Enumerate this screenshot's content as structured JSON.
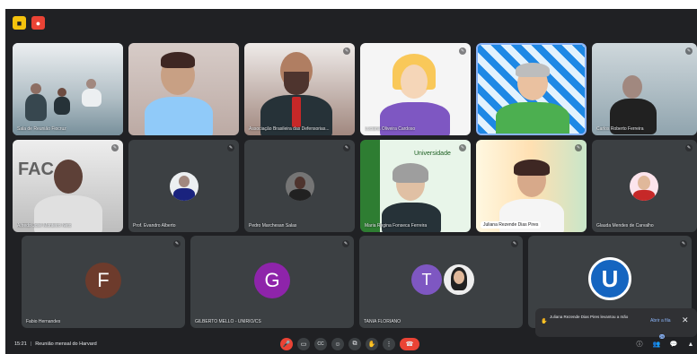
{
  "top_icons": [
    {
      "icon": "meet-logo-icon",
      "glyph": "■"
    },
    {
      "icon": "record-icon",
      "glyph": "●"
    }
  ],
  "participants": [
    {
      "name": "Sala de Reunião Fiocruz"
    },
    {
      "name": ""
    },
    {
      "name": "Associação Brasileira das Defensorias..."
    },
    {
      "name": "Luciana Oliveira Cardoso"
    },
    {
      "name": ""
    },
    {
      "name": "Carlos Roberto Ferreira"
    },
    {
      "name": "Alfredo José Monteiro Neto"
    },
    {
      "name": "Prof. Evandro Alberto"
    },
    {
      "name": "Pedro Marchesan Salas"
    },
    {
      "name": "Maria Regina Fonseca Ferreira"
    },
    {
      "name": "Juliana Rezende Dias Pires"
    },
    {
      "name": "Glauda Mendes de Carvalho"
    },
    {
      "name": "Fabio Hernandes",
      "letter": "F",
      "color": "#6d3b2c"
    },
    {
      "name": "GILBERTO MELLO - UNIRIO/CS",
      "letter": "G",
      "color": "#8e24aa"
    },
    {
      "name": "TANIA FLORIANO",
      "letter": "T",
      "color": "#7e57c2"
    },
    {
      "name": "",
      "letter": "U",
      "color": "#1565c0"
    }
  ],
  "toast": {
    "text": "Juliana Rezende Dias Pires levantou a mão",
    "link": "Abrir a fila",
    "close": "✕"
  },
  "meeting": {
    "time": "15:21",
    "title": "Reunião mensal do Harvard"
  },
  "controls": [
    {
      "icon": "mic-off-icon",
      "glyph": "🎤"
    },
    {
      "icon": "camera-icon",
      "glyph": "▭"
    },
    {
      "icon": "captions-icon",
      "glyph": "CC"
    },
    {
      "icon": "emoji-icon",
      "glyph": "☺"
    },
    {
      "icon": "present-icon",
      "glyph": "⧉"
    },
    {
      "icon": "raise-hand-icon",
      "glyph": "✋"
    },
    {
      "icon": "more-options-icon",
      "glyph": "⋮"
    },
    {
      "icon": "hang-up-icon",
      "glyph": "☎"
    }
  ],
  "right_controls": [
    {
      "icon": "info-icon",
      "glyph": "ⓘ"
    },
    {
      "icon": "people-icon",
      "glyph": "👥",
      "badge": "29"
    },
    {
      "icon": "chat-icon",
      "glyph": "💬"
    },
    {
      "icon": "activities-icon",
      "glyph": "▲"
    }
  ]
}
